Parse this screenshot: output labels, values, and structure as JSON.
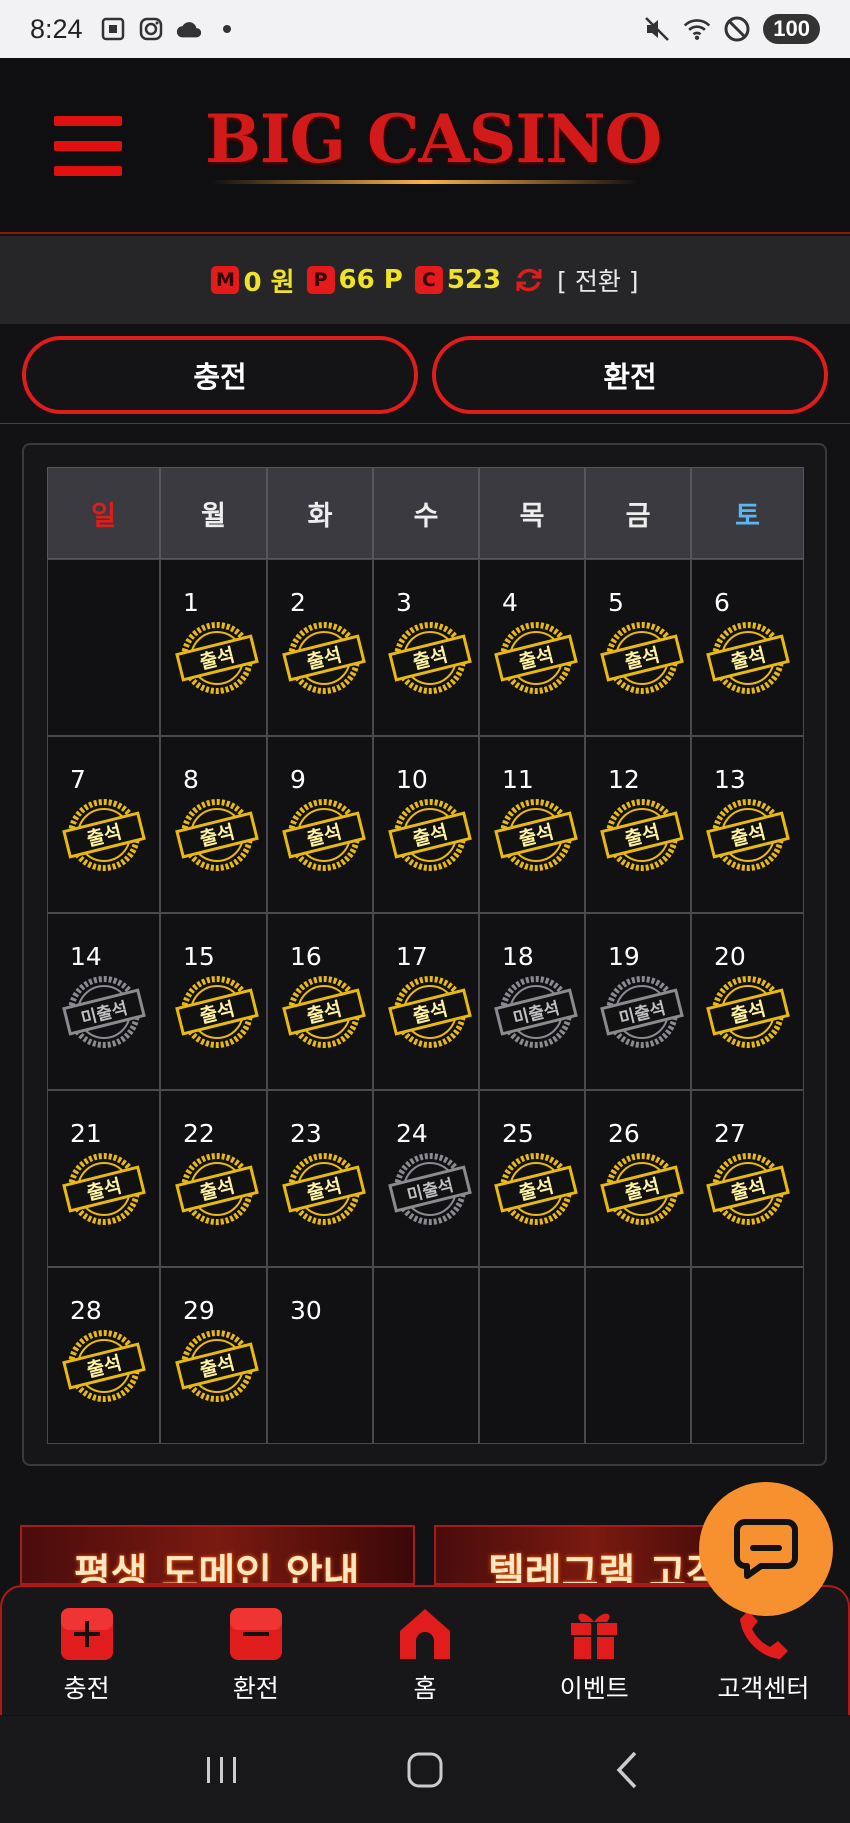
{
  "status_bar": {
    "time": "8:24",
    "battery": "100"
  },
  "header": {
    "logo": "BIG CASINO"
  },
  "balance": {
    "money_badge": "M",
    "money": "0 원",
    "point_badge": "P",
    "points": "66 P",
    "coin_badge": "C",
    "coins": "523",
    "switch_label": "[ 전환 ]"
  },
  "actions": {
    "charge": "충전",
    "exchange": "환전"
  },
  "calendar": {
    "weekdays": [
      "일",
      "월",
      "화",
      "수",
      "목",
      "금",
      "토"
    ],
    "weeks": [
      [
        {
          "day": "",
          "status": "empty"
        },
        {
          "day": "1",
          "status": "attended"
        },
        {
          "day": "2",
          "status": "attended"
        },
        {
          "day": "3",
          "status": "attended"
        },
        {
          "day": "4",
          "status": "attended"
        },
        {
          "day": "5",
          "status": "attended"
        },
        {
          "day": "6",
          "status": "attended"
        }
      ],
      [
        {
          "day": "7",
          "status": "attended"
        },
        {
          "day": "8",
          "status": "attended"
        },
        {
          "day": "9",
          "status": "attended"
        },
        {
          "day": "10",
          "status": "attended"
        },
        {
          "day": "11",
          "status": "attended"
        },
        {
          "day": "12",
          "status": "attended"
        },
        {
          "day": "13",
          "status": "attended"
        }
      ],
      [
        {
          "day": "14",
          "status": "absent"
        },
        {
          "day": "15",
          "status": "attended"
        },
        {
          "day": "16",
          "status": "attended"
        },
        {
          "day": "17",
          "status": "attended"
        },
        {
          "day": "18",
          "status": "absent"
        },
        {
          "day": "19",
          "status": "absent"
        },
        {
          "day": "20",
          "status": "attended"
        }
      ],
      [
        {
          "day": "21",
          "status": "attended"
        },
        {
          "day": "22",
          "status": "attended"
        },
        {
          "day": "23",
          "status": "attended"
        },
        {
          "day": "24",
          "status": "absent"
        },
        {
          "day": "25",
          "status": "attended"
        },
        {
          "day": "26",
          "status": "attended"
        },
        {
          "day": "27",
          "status": "attended"
        }
      ],
      [
        {
          "day": "28",
          "status": "attended"
        },
        {
          "day": "29",
          "status": "attended"
        },
        {
          "day": "30",
          "status": "none"
        },
        {
          "day": "",
          "status": "empty"
        },
        {
          "day": "",
          "status": "empty"
        },
        {
          "day": "",
          "status": "empty"
        },
        {
          "day": "",
          "status": "empty"
        }
      ]
    ],
    "stamp_attended": "출석",
    "stamp_absent": "미출석"
  },
  "banners": [
    "평생 도메인 안내",
    "텔레그램 고객"
  ],
  "bottom_nav": [
    {
      "label": "충전",
      "icon": "plus-icon"
    },
    {
      "label": "환전",
      "icon": "minus-icon"
    },
    {
      "label": "홈",
      "icon": "home-icon"
    },
    {
      "label": "이벤트",
      "icon": "gift-icon"
    },
    {
      "label": "고객센터",
      "icon": "phone-icon"
    }
  ],
  "colors": {
    "accent_red": "#e01c1c",
    "gold": "#f0c419",
    "fab_orange": "#f7902e",
    "saturday_blue": "#5bb7f0"
  }
}
